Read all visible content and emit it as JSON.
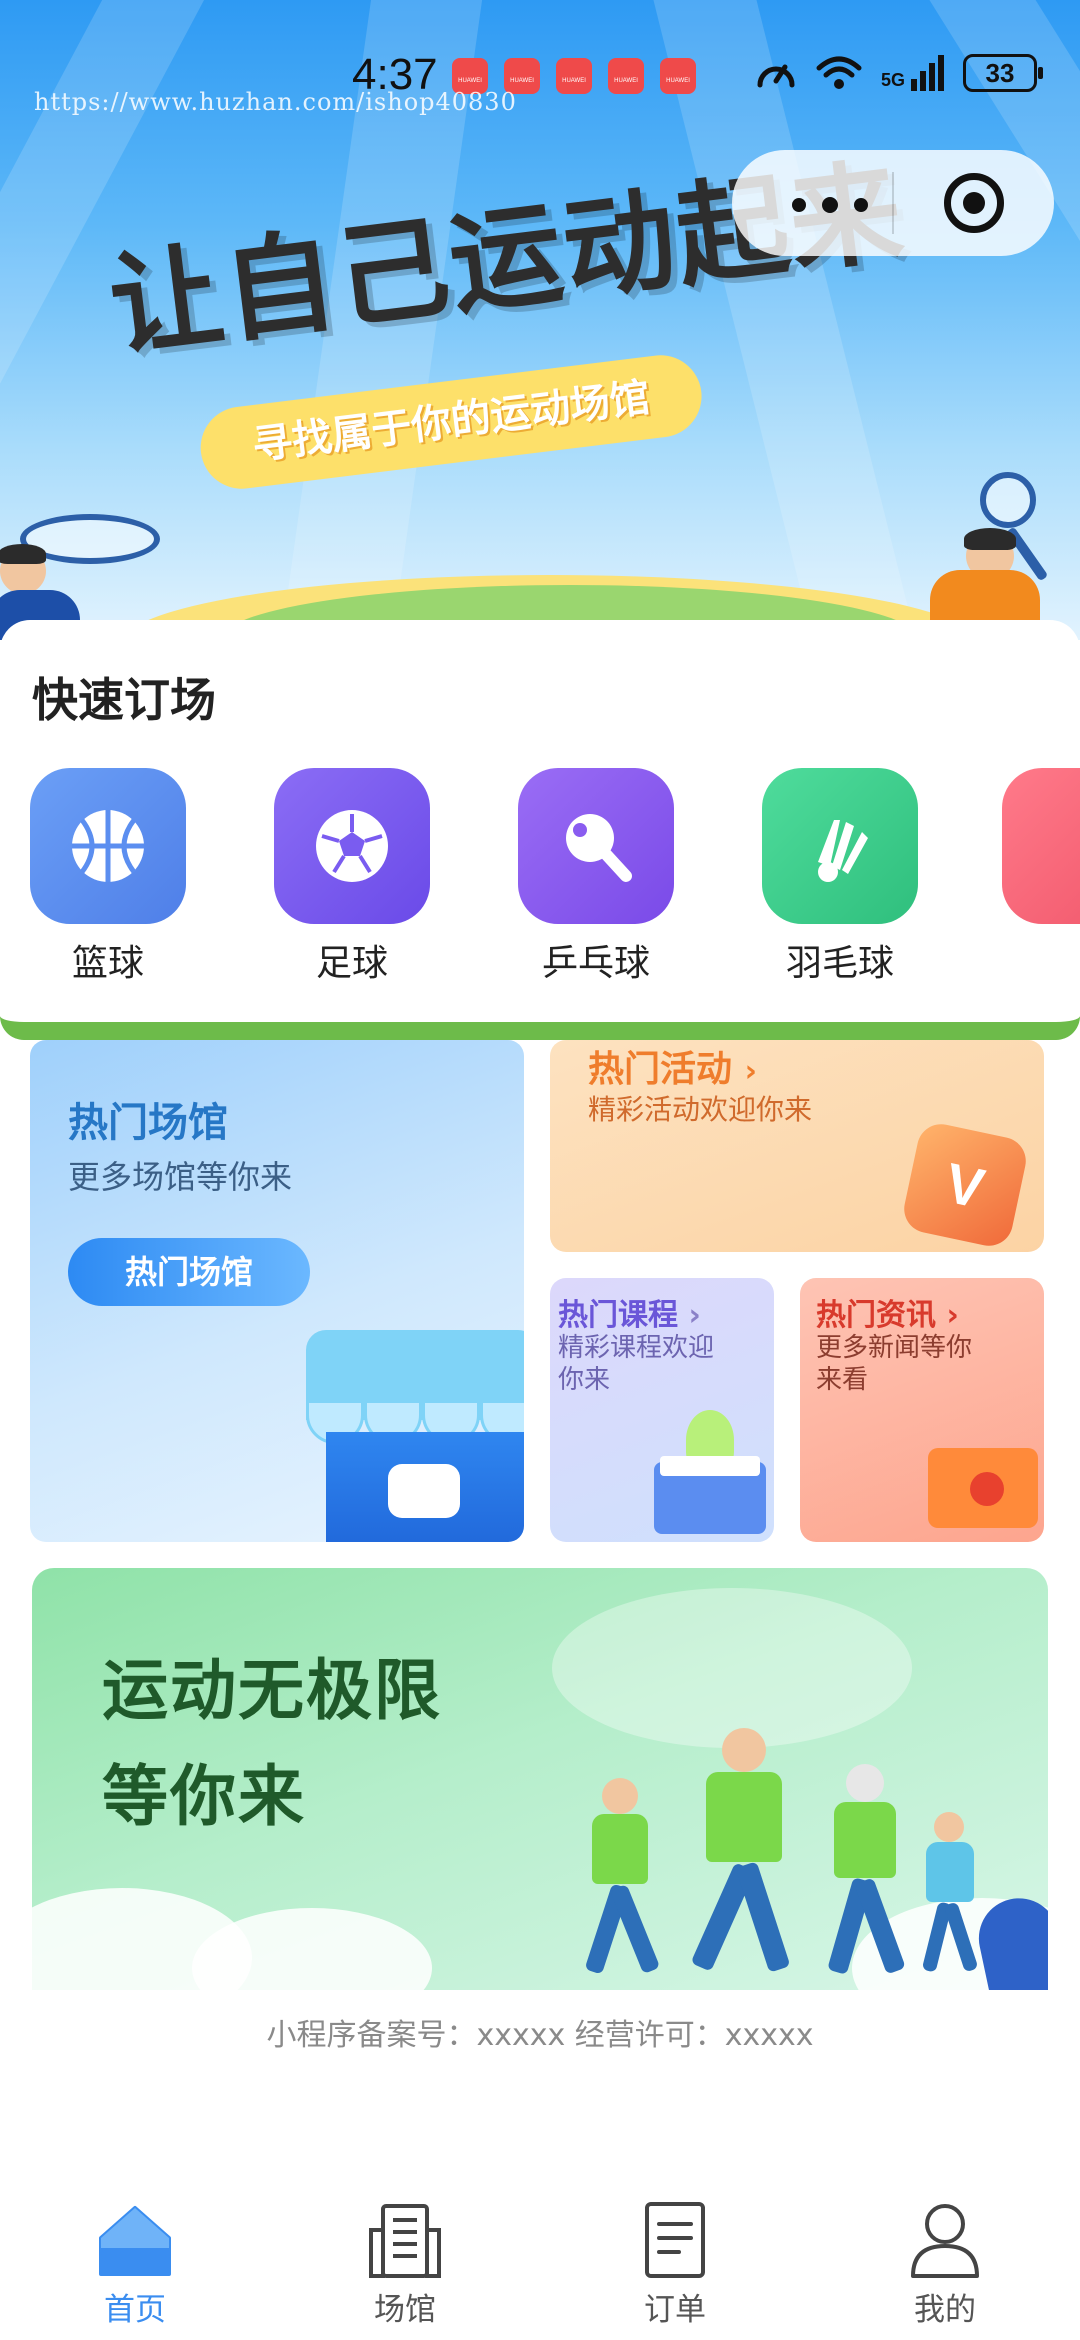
{
  "status_bar": {
    "time": "4:37",
    "notification_badge_label": "HUAWEI",
    "network": "5G",
    "battery": "33"
  },
  "watermark": "https://www.huzhan.com/ishop40830",
  "hero": {
    "title": "让自己运动起来",
    "subtitle": "寻找属于你的运动场馆"
  },
  "quick_booking": {
    "title": "快速订场",
    "sports": [
      {
        "label": "篮球",
        "icon": "basketball-icon",
        "color": "#5b8ef0"
      },
      {
        "label": "足球",
        "icon": "soccer-ball-icon",
        "color": "#7a5cf0"
      },
      {
        "label": "乒乓球",
        "icon": "ping-pong-paddle-icon",
        "color": "#8a5cf0"
      },
      {
        "label": "羽毛球",
        "icon": "shuttlecock-icon",
        "color": "#3ccf8e"
      }
    ]
  },
  "cards": {
    "venues": {
      "title": "热门场馆",
      "subtitle": "更多场馆等你来",
      "button": "热门场馆"
    },
    "activities": {
      "title": "热门活动",
      "subtitle": "精彩活动欢迎你来"
    },
    "courses": {
      "title": "热门课程",
      "subtitle": "精彩课程欢迎你来"
    },
    "news": {
      "title": "热门资讯",
      "subtitle": "更多新闻等你来看"
    }
  },
  "banner": {
    "line1": "运动无极限",
    "line2": "等你来"
  },
  "footer": {
    "icp": "小程序备案号：xxxxx   经营许可：xxxxx"
  },
  "tabbar": {
    "items": [
      {
        "label": "首页",
        "icon": "home-icon",
        "active": true
      },
      {
        "label": "场馆",
        "icon": "building-icon",
        "active": false
      },
      {
        "label": "订单",
        "icon": "document-icon",
        "active": false
      },
      {
        "label": "我的",
        "icon": "user-icon",
        "active": false
      }
    ]
  },
  "colors": {
    "accent": "#3a8df0",
    "green_strip": "#6dbb4a"
  }
}
